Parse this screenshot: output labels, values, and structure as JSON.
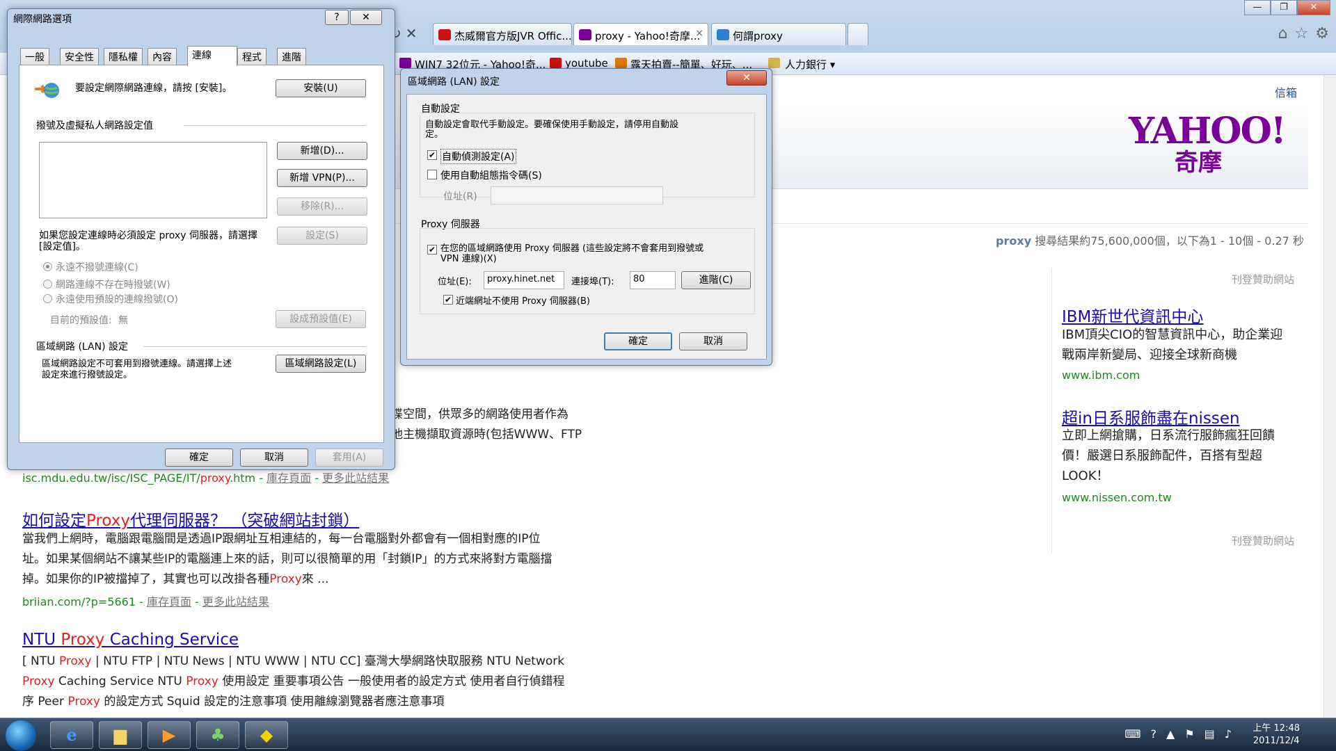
{
  "browser": {
    "tabs": [
      {
        "label": "杰威爾官方版JVR Offic...",
        "color": "#cc1111"
      },
      {
        "label": "proxy - Yahoo!奇摩...",
        "color": "#7b0099"
      },
      {
        "label": "何謂proxy",
        "color": "#2d7fd1"
      }
    ],
    "tab_close": "×",
    "nav_icons": [
      "refresh-icon",
      "stop-icon"
    ],
    "right_icons": [
      "home-icon",
      "favorites-star-icon",
      "settings-gear-icon"
    ],
    "favorites": [
      {
        "label": "WIN7 32位元 - Yahoo!奇...",
        "color": "#7b0099"
      },
      {
        "label": "youtube",
        "color": "#cc1111"
      },
      {
        "label": "露天拍賣--簡單、好玩、...",
        "color": "#e07b00"
      },
      {
        "label": "人力銀行 ▾",
        "color": "#d6b24a"
      }
    ]
  },
  "page": {
    "inbox_link": "信箱",
    "logo": "YAHOO!",
    "logo_sub": "奇摩",
    "result_query": "proxy",
    "result_count": "搜尋結果約75,600,000個，以下為1 - 10個 - 0.27 秒",
    "partial_result": {
      "snip1": "碟空間，供眾多的網路使用者作為",
      "snip2": "他主機擷取資源時(包括WWW、FTP",
      "url": "isc.mdu.edu.tw/isc/ISC_PAGE/IT/",
      "url_em": "proxy",
      "url_tail": ".htm",
      "cache": "庫存頁面",
      "more": "更多此站結果"
    },
    "results": [
      {
        "title_a": "如何設定",
        "title_em": "Proxy",
        "title_b": "代理伺服器？ （突破網站封鎖）",
        "line1": "當我們上網時，電腦跟電腦間是透過IP跟網址互相連結的，每一台電腦對外都會有一個相對應的IP位",
        "line2": "址。如果某個網站不讓某些IP的電腦連上來的話，則可以很簡單的用「封鎖IP」的方式來將對方電腦擋",
        "line3a": "掉。如果你的IP被擋掉了，其實也可以改掛各種",
        "line3em": "Proxy",
        "line3b": "來 ...",
        "url": "briian.com/?p=5661",
        "cache": "庫存頁面",
        "more": "更多此站結果"
      },
      {
        "title_a": "NTU ",
        "title_em": "Proxy",
        "title_b": " Caching Service",
        "line1a": "[ NTU ",
        "line1em": "Proxy",
        "line1b": " | NTU FTP | NTU News | NTU WWW | NTU CC] 臺灣大學網路快取服務 NTU Network",
        "line2em1": "Proxy",
        "line2a": " Caching Service NTU ",
        "line2em2": "Proxy",
        "line2b": " 使用設定 重要事項公告 一般使用者的設定方式 使用者自行偵錯程",
        "line3a": "序 Peer ",
        "line3em": "Proxy",
        "line3b": " 的設定方式 Squid 設定的注意事項 使用離線瀏覽器者應注意事項"
      }
    ],
    "ads": {
      "label": "刊登贊助網站",
      "items": [
        {
          "title": "IBM新世代資訊中心",
          "desc1": "IBM頂尖CIO的智慧資訊中心，助企業迎",
          "desc2": "戰兩岸新變局、迎接全球新商機",
          "url": "www.ibm.com"
        },
        {
          "title": "超in日系服飾盡在nissen",
          "desc1": "立即上網搶購，日系流行服飾瘋狂回饋",
          "desc2": "價！嚴選日系服飾配件，百搭有型超",
          "desc3": "LOOK！",
          "url": "www.nissen.com.tw"
        }
      ]
    }
  },
  "inet_options": {
    "title": "網際網路選項",
    "help": "?",
    "close": "✕",
    "tabs": [
      "一般",
      "安全性",
      "隱私權",
      "內容",
      "連線",
      "程式",
      "進階"
    ],
    "setup_text": "要設定網際網路連線，請按 [安裝]。",
    "setup_btn": "安裝(U)",
    "dialup_group": "撥號及虛擬私人網路設定值",
    "add_btn": "新增(D)...",
    "add_vpn_btn": "新增 VPN(P)...",
    "remove_btn": "移除(R)...",
    "settings_text1": "如果您設定連線時必須設定 proxy 伺服器，請選擇",
    "settings_text2": "[設定值]。",
    "settings_btn": "設定(S)",
    "radio1": "永遠不撥號連線(C)",
    "radio2": "網路連線不存在時撥號(W)",
    "radio3": "永遠使用預設的連線撥號(O)",
    "current_default": "目前的預設值:",
    "current_value": "無",
    "set_default_btn": "設成預設值(E)",
    "lan_group": "區域網路 (LAN) 設定",
    "lan_text1": "區域網路設定不可套用到撥號連線。請選擇上述",
    "lan_text2": "設定來進行撥號設定。",
    "lan_btn": "區域網路設定(L)",
    "ok": "確定",
    "cancel": "取消",
    "apply": "套用(A)"
  },
  "lan_dialog": {
    "title": "區域網路 (LAN) 設定",
    "close": "✕",
    "auto_group": "自動設定",
    "auto_text1": "自動設定會取代手動設定。要確保使用手動設定，請停用自動設",
    "auto_text2": "定。",
    "auto_detect": "自動偵測設定(A)",
    "auto_detect_checked": true,
    "auto_script": "使用自動組態指令碼(S)",
    "auto_script_checked": false,
    "address_label": "位址(R)",
    "proxy_group": "Proxy 伺服器",
    "use_proxy1": "在您的區域網路使用 Proxy 伺服器 (這些設定將不會套用到撥號或",
    "use_proxy2": "VPN 連線)(X)",
    "use_proxy_checked": true,
    "proxy_address_label": "位址(E):",
    "proxy_address": "proxy.hinet.net",
    "port_label": "連接埠(T):",
    "port": "80",
    "advanced_btn": "進階(C)",
    "bypass": "近端網址不使用 Proxy 伺服器(B)",
    "bypass_checked": true,
    "ok": "確定",
    "cancel": "取消"
  },
  "taskbar": {
    "apps": [
      "internet-explorer-icon",
      "file-explorer-icon",
      "media-player-icon",
      "network-app-icon",
      "kuaibo-icon"
    ],
    "time": "上午 12:48",
    "date": "2011/12/4"
  }
}
